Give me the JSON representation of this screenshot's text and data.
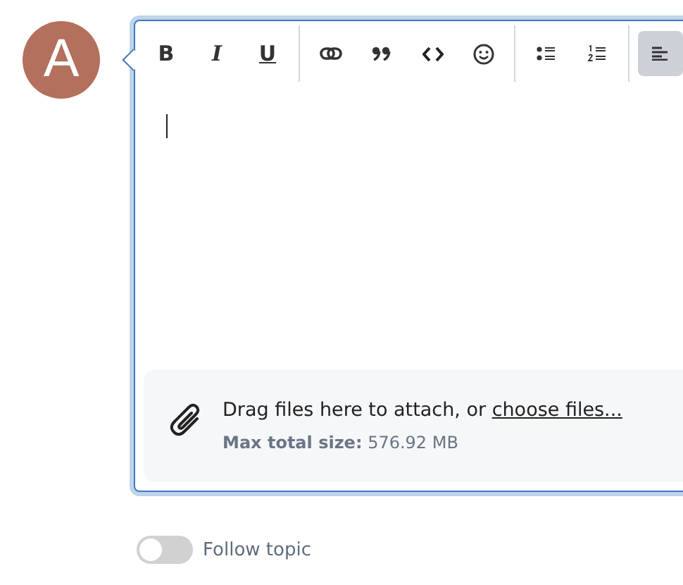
{
  "avatar": {
    "letter": "A",
    "color": "#b3705c"
  },
  "toolbar": [
    [
      {
        "kind": "bold",
        "label": "B",
        "selected": false
      },
      {
        "kind": "italic",
        "label": "I",
        "selected": false
      },
      {
        "kind": "underline",
        "label": "U",
        "selected": false
      }
    ],
    [
      {
        "kind": "link",
        "selected": false
      },
      {
        "kind": "quote",
        "selected": false
      },
      {
        "kind": "code",
        "selected": false
      },
      {
        "kind": "emoji",
        "selected": false
      }
    ],
    [
      {
        "kind": "bullets",
        "selected": false
      },
      {
        "kind": "numbers",
        "selected": false
      }
    ],
    [
      {
        "kind": "align-left",
        "selected": true
      }
    ]
  ],
  "dropzone": {
    "text": "Drag files here to attach, or ",
    "link": "choose files...",
    "size_label": "Max total size:",
    "size_value": "576.92 MB"
  },
  "follow": {
    "label": "Follow topic",
    "on": false
  }
}
